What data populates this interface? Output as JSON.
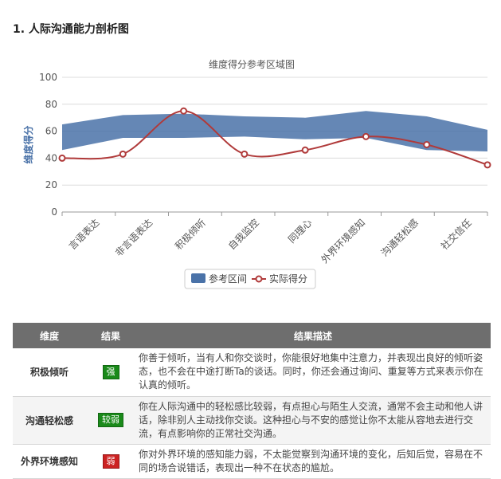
{
  "section": {
    "title": "1. 人际沟通能力剖析图"
  },
  "chart_data": {
    "type": "area",
    "title": "维度得分参考区域图",
    "ylabel": "维度得分",
    "ylim": [
      0,
      100
    ],
    "yticks": [
      0,
      20,
      40,
      60,
      80,
      100
    ],
    "grid": true,
    "categories": [
      "言语表达",
      "非言语表达",
      "积极倾听",
      "自我监控",
      "同理心",
      "外界环境感知",
      "沟通轻松感",
      "社交信任"
    ],
    "series": [
      {
        "name": "参考区间",
        "kind": "range",
        "color": "#4a72a8",
        "low": [
          46,
          55,
          55,
          56,
          54,
          55,
          46,
          45
        ],
        "high": [
          65,
          72,
          73,
          71,
          70,
          75,
          71,
          61
        ]
      },
      {
        "name": "实际得分",
        "kind": "line",
        "color": "#b03a3a",
        "values": [
          40,
          43,
          75,
          43,
          46,
          56,
          50,
          35
        ]
      }
    ],
    "legend": "bottom-center"
  },
  "table": {
    "headers": [
      "维度",
      "结果",
      "结果描述"
    ],
    "rows": [
      {
        "dimension": "积极倾听",
        "result": "强",
        "result_color": "#1a8a1a",
        "description": "你善于倾听，当有人和你交谈时，你能很好地集中注意力，并表现出良好的倾听姿态，也不会在中途打断Ta的谈话。同时，你还会通过询问、重复等方式来表示你在认真的倾听。"
      },
      {
        "dimension": "沟通轻松感",
        "result": "较弱",
        "result_color": "#1a8a1a",
        "description": "你在人际沟通中的轻松感比较弱，有点担心与陌生人交流，通常不会主动和他人讲话，除非别人主动找你交谈。这种担心与不安的感觉让你不太能从容地去进行交流，有点影响你的正常社交沟通。"
      },
      {
        "dimension": "外界环境感知",
        "result": "弱",
        "result_color": "#cc2222",
        "description": "你对外界环境的感知能力弱，不太能觉察到沟通环境的变化，后知后觉，容易在不同的场合说错话，表现出一种不在状态的尴尬。"
      }
    ]
  }
}
